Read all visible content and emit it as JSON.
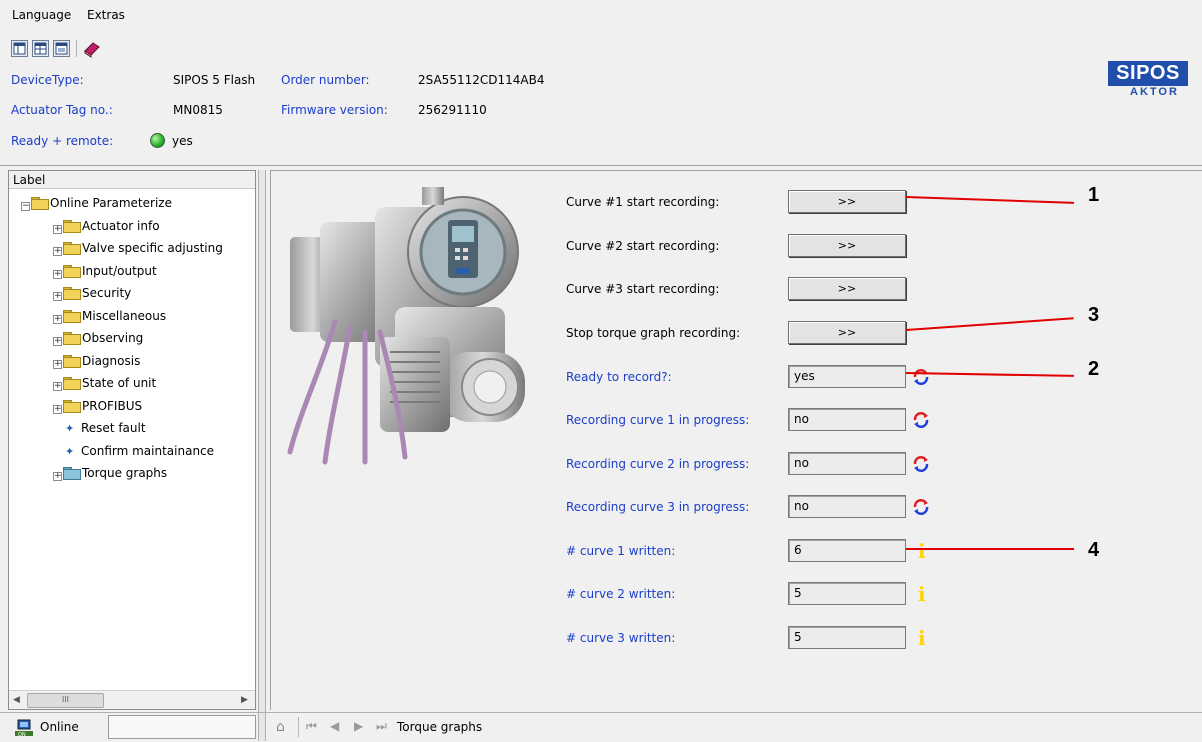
{
  "menu": {
    "language": "Language",
    "extras": "Extras"
  },
  "toolbar": {
    "icons": [
      "layout-tree-icon",
      "layout-grid-icon",
      "layout-detail-icon",
      "book-icon"
    ]
  },
  "header": {
    "device_type_label": "DeviceType:",
    "device_type_value": "SIPOS 5 Flash",
    "order_number_label": "Order number:",
    "order_number_value": "2SA55112CD114AB4",
    "tag_label": "Actuator Tag no.:",
    "tag_value": "MN0815",
    "firmware_label": "Firmware version:",
    "firmware_value": "256291110",
    "ready_label": "Ready + remote:",
    "ready_value": "yes",
    "ready_led_color": "#2fb32f"
  },
  "logo": {
    "main": "SIPOS",
    "sub": "AKTOR",
    "color": "#1f4eab"
  },
  "tree": {
    "header": "Label",
    "root": "Online Parameterize",
    "items": [
      {
        "label": "Actuator info",
        "type": "folder"
      },
      {
        "label": "Valve specific adjusting",
        "type": "folder"
      },
      {
        "label": "Input/output",
        "type": "folder"
      },
      {
        "label": "Security",
        "type": "folder"
      },
      {
        "label": "Miscellaneous",
        "type": "folder"
      },
      {
        "label": "Observing",
        "type": "folder"
      },
      {
        "label": "Diagnosis",
        "type": "folder"
      },
      {
        "label": "State of unit",
        "type": "folder"
      },
      {
        "label": "PROFIBUS",
        "type": "folder"
      },
      {
        "label": "Reset fault",
        "type": "action"
      },
      {
        "label": "Confirm maintainance",
        "type": "action"
      },
      {
        "label": "Torque graphs",
        "type": "folder-selected"
      }
    ],
    "scroll_thumb": "III"
  },
  "form": {
    "button_label": ">>",
    "rows": [
      {
        "label": "Curve #1 start recording:",
        "kind": "button"
      },
      {
        "label": "Curve #2 start recording:",
        "kind": "button"
      },
      {
        "label": "Curve #3 start recording:",
        "kind": "button"
      },
      {
        "label": "Stop torque graph recording:",
        "kind": "button"
      },
      {
        "label": "Ready to record?:",
        "kind": "value",
        "value": "yes",
        "icon": "refresh-icon"
      },
      {
        "label": "Recording curve 1 in progress:",
        "kind": "value",
        "value": "no",
        "icon": "refresh-icon"
      },
      {
        "label": "Recording curve 2 in progress:",
        "kind": "value",
        "value": "no",
        "icon": "refresh-icon"
      },
      {
        "label": "Recording curve 3 in progress:",
        "kind": "value",
        "value": "no",
        "icon": "refresh-icon"
      },
      {
        "label": "# curve 1 written:",
        "kind": "value",
        "value": "6",
        "icon": "info-icon"
      },
      {
        "label": "# curve 2 written:",
        "kind": "value",
        "value": "5",
        "icon": "info-icon"
      },
      {
        "label": "# curve 3 written:",
        "kind": "value",
        "value": "5",
        "icon": "info-icon"
      }
    ]
  },
  "callouts": [
    "1",
    "3",
    "2",
    "4"
  ],
  "bottom": {
    "online_label": "Online",
    "breadcrumb": "Torque graphs",
    "nav_icons": [
      "home-icon",
      "first-icon",
      "back-icon",
      "forward-icon",
      "last-icon"
    ]
  },
  "colors": {
    "blue_label": "#1a3ec8",
    "callout_line": "#e00000",
    "info_icon": "#ffd400"
  }
}
